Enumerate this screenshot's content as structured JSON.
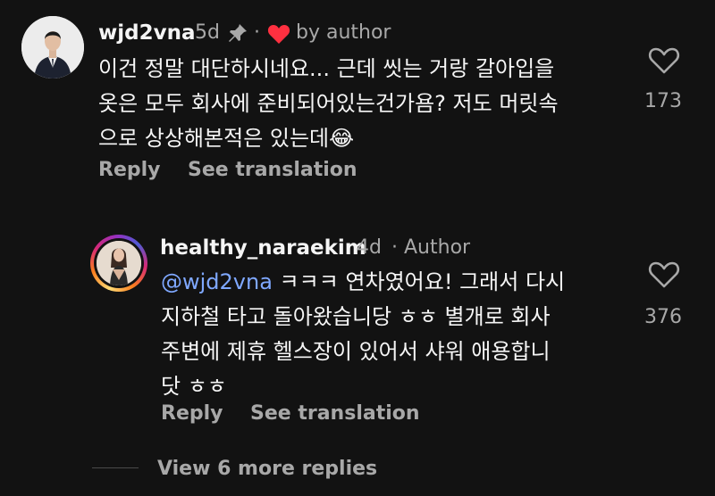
{
  "comment": {
    "username": "wjd2vna",
    "time": "5d",
    "by_author": "by author",
    "lines": [
      "이건 정말 대단하시네요... 근데 씻는 거랑 갈아입을",
      "옷은 모두 회사에 준비되어있는건가욤? 저도 머릿속",
      "으로 상상해본적은 있는데"
    ],
    "emoji": "😂",
    "reply_label": "Reply",
    "translate_label": "See translation",
    "likes": "173"
  },
  "reply": {
    "username": "healthy_naraekim",
    "time": "4d",
    "author_tag": "Author",
    "mention": "@wjd2vna",
    "first_line_rest": " ㅋㅋㅋ 연차였어요! 그래서 다시",
    "lines": [
      "지하철 타고 돌아왔습니당 ㅎㅎ 별개로 회사",
      "주변에 제휴 헬스장이 있어서 샤워 애용합니",
      "닷 ㅎㅎ"
    ],
    "reply_label": "Reply",
    "translate_label": "See translation",
    "likes": "376"
  },
  "more_replies_label": "View 6 more replies",
  "colors": {
    "background": "#121212",
    "primary_text": "#f5f5f5",
    "secondary_text": "#a8a8a8",
    "mention": "#7fa8ff",
    "heart_red": "#ff3040"
  }
}
